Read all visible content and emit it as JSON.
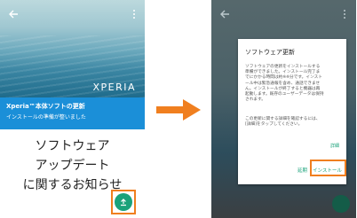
{
  "left_screen": {
    "brand": "XPERIA",
    "update_title": "Xperia™本体ソフトの更新",
    "update_subtitle": "インストールの準備が整いました",
    "big_text": [
      "ソフトウェア",
      "アップデート",
      "に関するお知らせ"
    ],
    "back_icon": "arrow-left",
    "menu_icon": "more-vert",
    "fab_icon": "upload"
  },
  "dialog": {
    "title": "ソフトウェア更新",
    "body": [
      "ソフトウェアの更新をインストールする",
      "準備ができました。インストール完了ま",
      "でにかかる時間は約※※分です。インスト",
      "ール中は緊急通報を含め、通話できませ",
      "ん。インストールが終了すると機器は再",
      "起動します。既存のユーザーデータは保持",
      "されます。"
    ],
    "body2": [
      "この更新に関する詳細を確認するには、",
      "[詳細]をタップしてください。"
    ],
    "detail_label": "詳細",
    "cancel_label": "延期",
    "install_label": "インストール"
  },
  "colors": {
    "accent_green": "#1aa27a",
    "highlight_orange": "#f07f1f",
    "band_blue": "#1b8fd8"
  }
}
